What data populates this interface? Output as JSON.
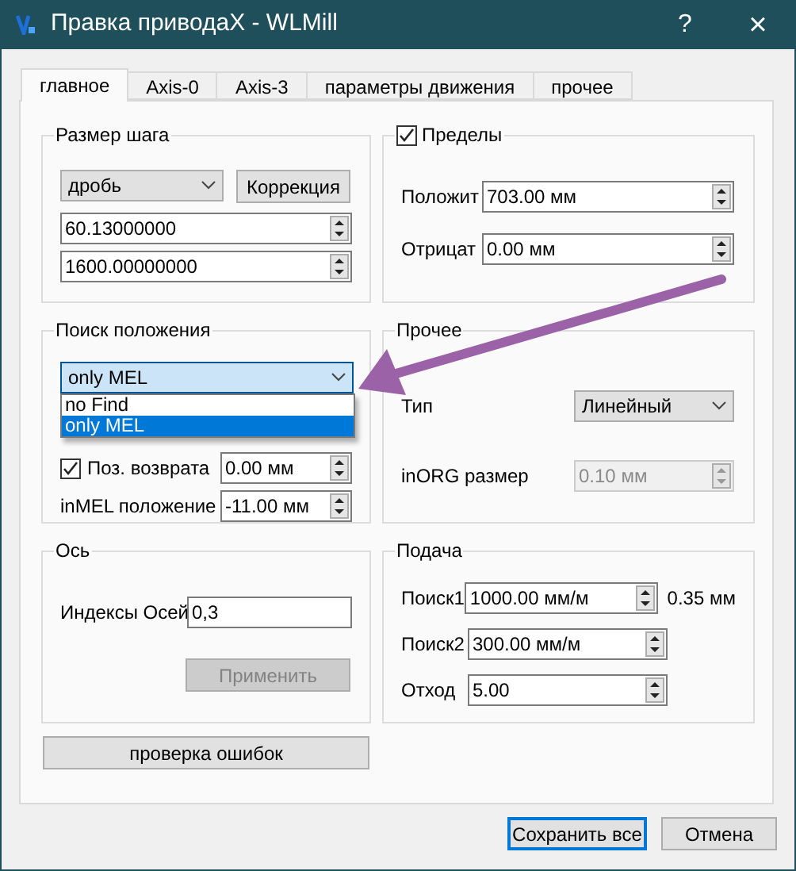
{
  "window": {
    "title": "Правка приводаX - WLMill",
    "help": "?",
    "close": "×"
  },
  "tabs": [
    {
      "label": "главное",
      "selected": true
    },
    {
      "label": "Axis-0",
      "selected": false
    },
    {
      "label": "Axis-3",
      "selected": false
    },
    {
      "label": "параметры движения",
      "selected": false
    },
    {
      "label": "прочее",
      "selected": false
    }
  ],
  "step_size": {
    "title": "Размер шага",
    "mode": "дробь",
    "correction_button": "Коррекция",
    "values": [
      "60.13000000",
      "1600.00000000"
    ]
  },
  "limits": {
    "title": "Пределы",
    "checked": true,
    "fields": [
      {
        "label": "Положит",
        "value": "703.00 мм"
      },
      {
        "label": "Отрицат",
        "value": "0.00 мм"
      }
    ]
  },
  "position_search": {
    "title": "Поиск положения",
    "combo": {
      "value": "only MEL",
      "expanded": true,
      "options": [
        {
          "label": "no Find",
          "selected": false
        },
        {
          "label": "only MEL",
          "selected": true
        }
      ]
    },
    "return_position": {
      "label": "Поз. возврата",
      "checked": true,
      "value": "0.00 мм"
    },
    "inmel": {
      "label": "inMEL положение",
      "value": "-11.00 мм"
    }
  },
  "other": {
    "title": "Прочее",
    "type": {
      "label": "Тип",
      "value": "Линейный"
    },
    "inorg": {
      "label": "inORG размер",
      "value": "0.10 мм",
      "disabled": true
    }
  },
  "axis": {
    "title": "Ось",
    "label": "Индексы Осей",
    "value": "0,3",
    "apply_button": {
      "label": "Применить",
      "disabled": true
    }
  },
  "feed": {
    "title": "Подача",
    "fields": [
      {
        "label": "Поиск1",
        "value": "1000.00 мм/м",
        "note": "0.35 мм"
      },
      {
        "label": "Поиск2",
        "value": "300.00 мм/м"
      },
      {
        "label": "Отход",
        "value": "5.00"
      }
    ]
  },
  "error_check_button": "проверка ошибок",
  "buttons": [
    {
      "label": "Сохранить все",
      "default": true
    },
    {
      "label": "Отмена",
      "default": false
    }
  ]
}
